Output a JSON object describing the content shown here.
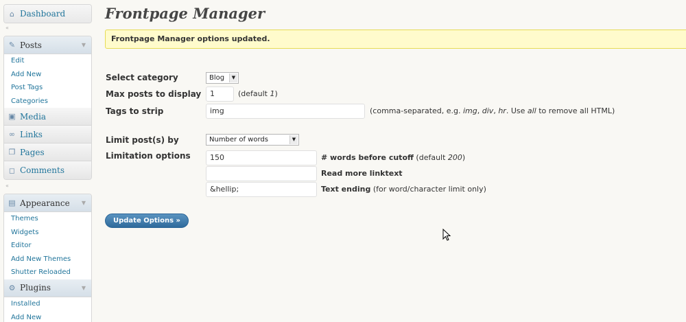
{
  "sidebar": {
    "dashboard": {
      "label": "Dashboard",
      "icon": "house-icon"
    },
    "posts": {
      "label": "Posts",
      "icon": "pin-icon",
      "items": [
        "Edit",
        "Add New",
        "Post Tags",
        "Categories"
      ]
    },
    "media": {
      "label": "Media",
      "icon": "media-icon"
    },
    "links": {
      "label": "Links",
      "icon": "link-icon"
    },
    "pages": {
      "label": "Pages",
      "icon": "pages-icon"
    },
    "comments": {
      "label": "Comments",
      "icon": "comment-icon"
    },
    "appearance": {
      "label": "Appearance",
      "icon": "appearance-icon",
      "items": [
        "Themes",
        "Widgets",
        "Editor",
        "Add New Themes",
        "Shutter Reloaded"
      ]
    },
    "plugins": {
      "label": "Plugins",
      "icon": "plugin-icon",
      "items": [
        "Installed",
        "Add New"
      ]
    }
  },
  "main": {
    "title": "Frontpage Manager",
    "notice": "Frontpage Manager options updated.",
    "form": {
      "category": {
        "label": "Select category",
        "value": "Blog"
      },
      "max_posts": {
        "label": "Max posts to display",
        "value": "1",
        "hint_pre": "(default ",
        "hint_val": "1",
        "hint_post": ")"
      },
      "tags": {
        "label": "Tags to strip",
        "value": "img",
        "hint_pre": "(comma-separated, e.g. ",
        "hint_e1": "img",
        "hint_sep1": ", ",
        "hint_e2": "div",
        "hint_sep2": ", ",
        "hint_e3": "hr",
        "hint_mid": ". Use ",
        "hint_all": "all",
        "hint_post": " to remove all HTML)"
      },
      "limit_by": {
        "label": "Limit post(s) by",
        "value": "Number of words"
      },
      "limitation": {
        "label": "Limitation options",
        "words": {
          "value": "150",
          "label": "# words before cutoff",
          "hint_pre": " (default ",
          "hint_val": "200",
          "hint_post": ")"
        },
        "readmore": {
          "value": "",
          "label": "Read more linktext"
        },
        "ending": {
          "value": "&hellip;",
          "label": "Text ending",
          "hint": " (for word/character limit only)"
        }
      }
    },
    "update_button": "Update Options »"
  },
  "colors": {
    "link": "#21759b",
    "notice_bg": "#fffbcc",
    "notice_border": "#e6db55",
    "button": "#2f6b9c"
  }
}
